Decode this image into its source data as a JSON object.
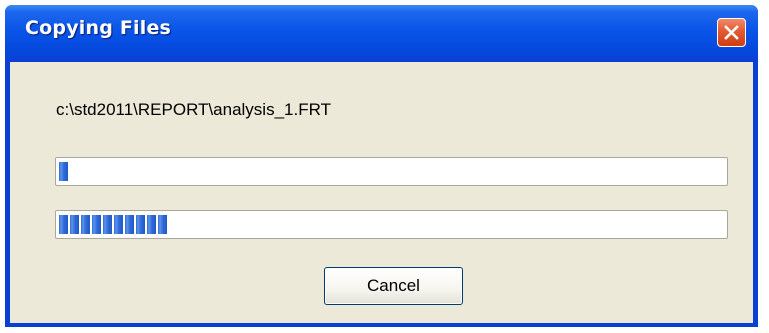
{
  "window": {
    "title": "Copying Files"
  },
  "dialog": {
    "file_path": "c:\\std2011\\REPORT\\analysis_1.FRT",
    "file_progress_percent": 2,
    "total_progress_percent": 17,
    "cancel_label": "Cancel"
  },
  "icons": {
    "close": "close-icon"
  },
  "colors": {
    "titlebar": "#0a54e8",
    "dialog_background": "#ece9d8",
    "progress_fill": "#2f6ad6",
    "close_button": "#e35a32"
  }
}
